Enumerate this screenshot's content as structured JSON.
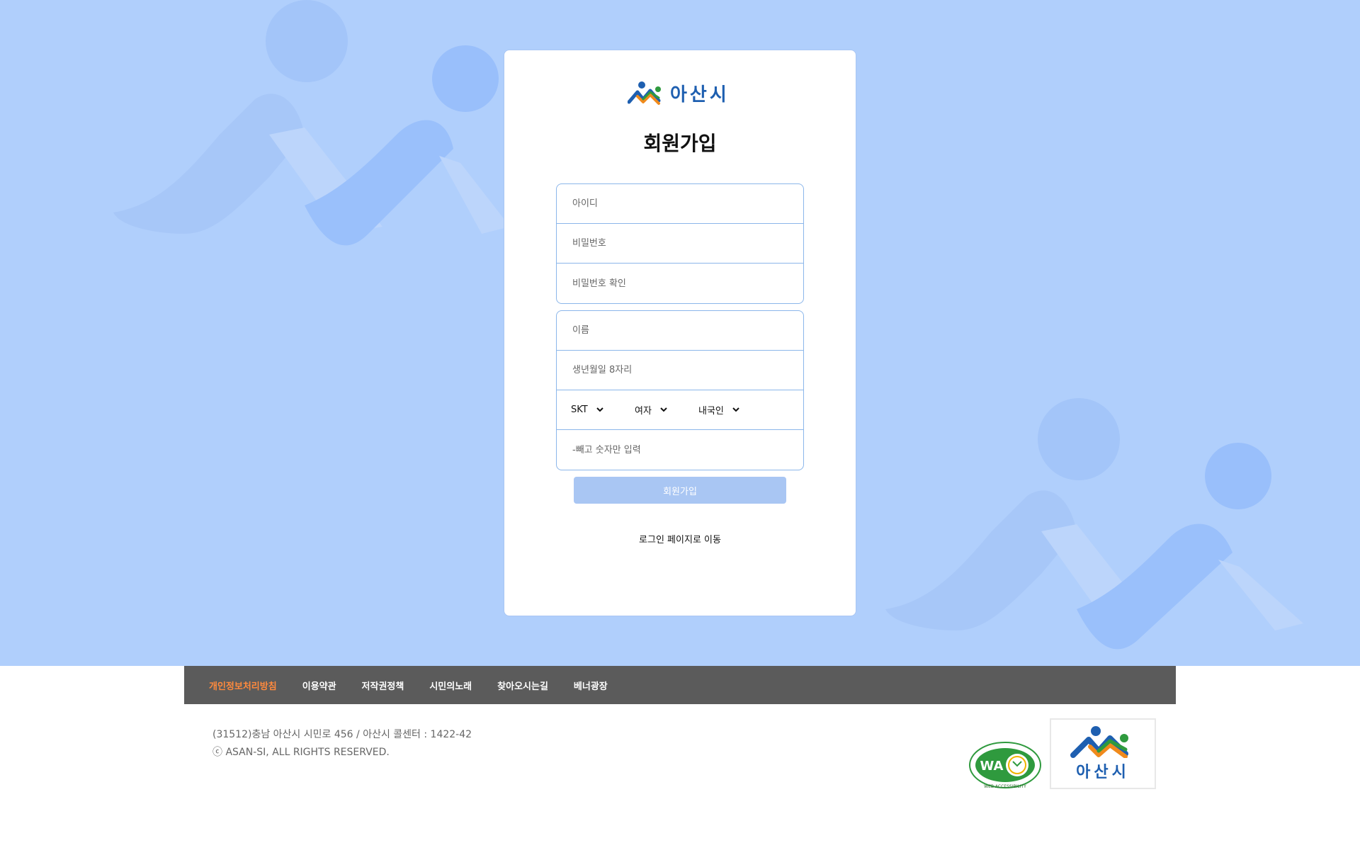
{
  "brand": {
    "logo_text": "아산시",
    "colors": {
      "blue": "#1e5fb0",
      "green": "#2f9a3e",
      "orange": "#f08a1c",
      "hero_bg": "#b0cffc"
    }
  },
  "form": {
    "title": "회원가입",
    "account_fields": [
      {
        "placeholder": "아이디"
      },
      {
        "placeholder": "비밀번호"
      },
      {
        "placeholder": "비밀번호 확인"
      }
    ],
    "profile_fields": {
      "name_placeholder": "이름",
      "birth_placeholder": "생년월일 8자리",
      "carrier": "SKT",
      "gender": "여자",
      "nationality": "내국인",
      "phone_placeholder": "-빼고 숫자만 입력"
    },
    "submit_label": "회원가입",
    "login_link": "로그인 페이지로 이동"
  },
  "footer": {
    "nav": [
      "개인정보처리방침",
      "이용약관",
      "저작권정책",
      "시민의노래",
      "찾아오시는길",
      "베너광장"
    ],
    "address": "(31512)충남 아산시 시민로 456 / 아산시 콜센터 : 1422-42",
    "copyright": "ⓒ ASAN-SI, ALL RIGHTS RESERVED.",
    "wa_badge_text": "WA",
    "wa_badge_caption": "WEB ACCESSIBILITY",
    "asan_logo_text": "아산시"
  }
}
